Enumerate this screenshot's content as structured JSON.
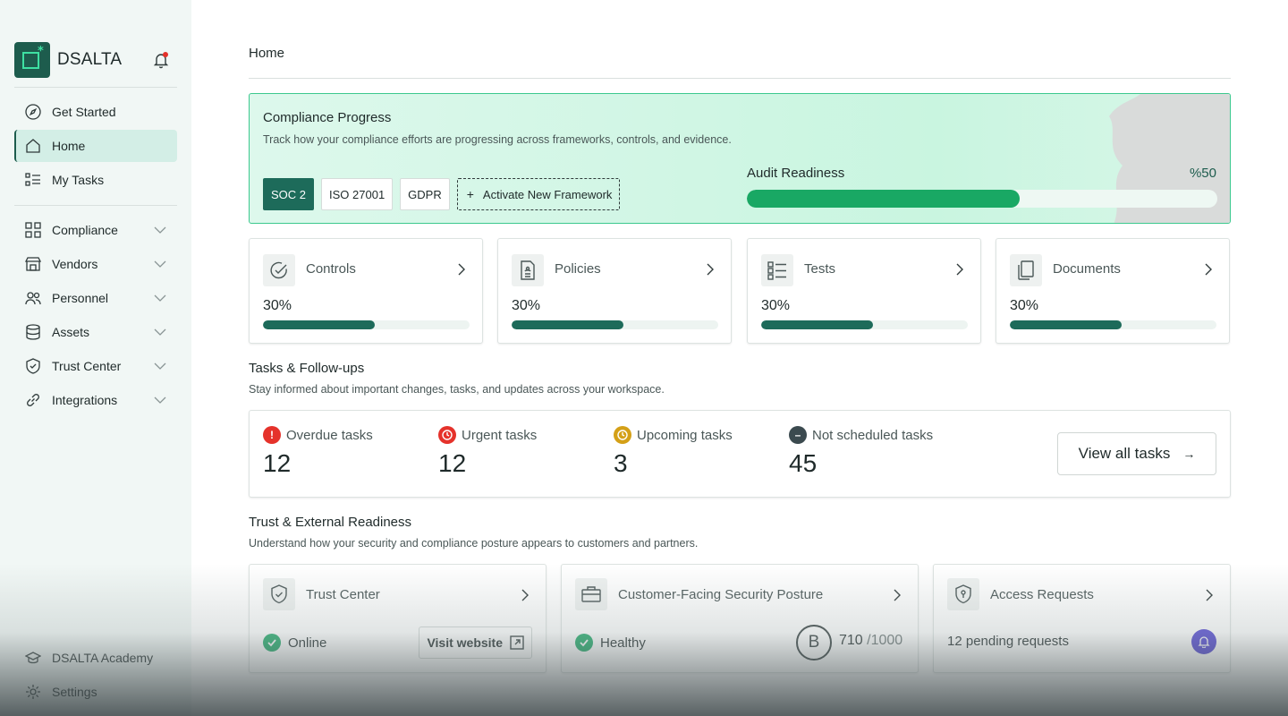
{
  "brand": {
    "name": "DSALTA"
  },
  "sidebar": {
    "top_items": [
      {
        "label": "Get Started",
        "icon": "compass-icon"
      },
      {
        "label": "Home",
        "icon": "home-icon",
        "active": true
      },
      {
        "label": "My Tasks",
        "icon": "checklist-icon"
      }
    ],
    "group_items": [
      {
        "label": "Compliance",
        "icon": "grid-icon"
      },
      {
        "label": "Vendors",
        "icon": "store-icon"
      },
      {
        "label": "Personnel",
        "icon": "users-icon"
      },
      {
        "label": "Assets",
        "icon": "database-icon"
      },
      {
        "label": "Trust Center",
        "icon": "shield-check-icon"
      },
      {
        "label": "Integrations",
        "icon": "link-icon"
      }
    ],
    "bottom_items": [
      {
        "label": "DSALTA Academy",
        "icon": "graduation-cap-icon"
      },
      {
        "label": "Settings",
        "icon": "gear-icon"
      }
    ]
  },
  "header": {
    "title": "Home"
  },
  "compliance": {
    "title": "Compliance Progress",
    "subtitle": "Track how your compliance efforts are progressing across frameworks, controls, and evidence.",
    "frameworks": [
      "SOC 2",
      "ISO 27001",
      "GDPR"
    ],
    "activate_label": "Activate New Framework",
    "audit_label": "Audit Readiness",
    "audit_value": "%50",
    "audit_fraction": 0.58
  },
  "metrics": [
    {
      "label": "Controls",
      "value": "30%",
      "fraction": 0.54,
      "icon": "check-circle-icon"
    },
    {
      "label": "Policies",
      "value": "30%",
      "fraction": 0.54,
      "icon": "document-icon"
    },
    {
      "label": "Tests",
      "value": "30%",
      "fraction": 0.54,
      "icon": "checklist-icon"
    },
    {
      "label": "Documents",
      "value": "30%",
      "fraction": 0.54,
      "icon": "copy-icon"
    }
  ],
  "tasks_section": {
    "title": "Tasks & Follow-ups",
    "subtitle": "Stay informed about important changes, tasks, and updates across your workspace.",
    "items": [
      {
        "label": "Overdue tasks",
        "count": "12",
        "color": "#e5322b",
        "icon": "alert-icon"
      },
      {
        "label": "Urgent tasks",
        "count": "12",
        "color": "#e5322b",
        "icon": "clock-alert-icon"
      },
      {
        "label": "Upcoming tasks",
        "count": "3",
        "color": "#d4a017",
        "icon": "clock-icon"
      },
      {
        "label": "Not scheduled tasks",
        "count": "45",
        "color": "#3b4a4f",
        "icon": "minus-circle-icon"
      }
    ],
    "view_all_label": "View all tasks"
  },
  "trust_section": {
    "title": "Trust & External Readiness",
    "subtitle": "Understand how your security and compliance posture appears to customers and partners.",
    "trust_center": {
      "label": "Trust Center",
      "status": "Online",
      "visit_label": "Visit website"
    },
    "posture": {
      "label": "Customer-Facing Security Posture",
      "status": "Healthy",
      "grade": "B",
      "score": "710",
      "score_max": "/1000"
    },
    "access": {
      "label": "Access Requests",
      "pending": "12 pending requests"
    }
  },
  "colors": {
    "accent": "#1d6b5a",
    "brand": "#1d5c4d",
    "progress": "#19a864",
    "badge": "#4b3fd1"
  }
}
